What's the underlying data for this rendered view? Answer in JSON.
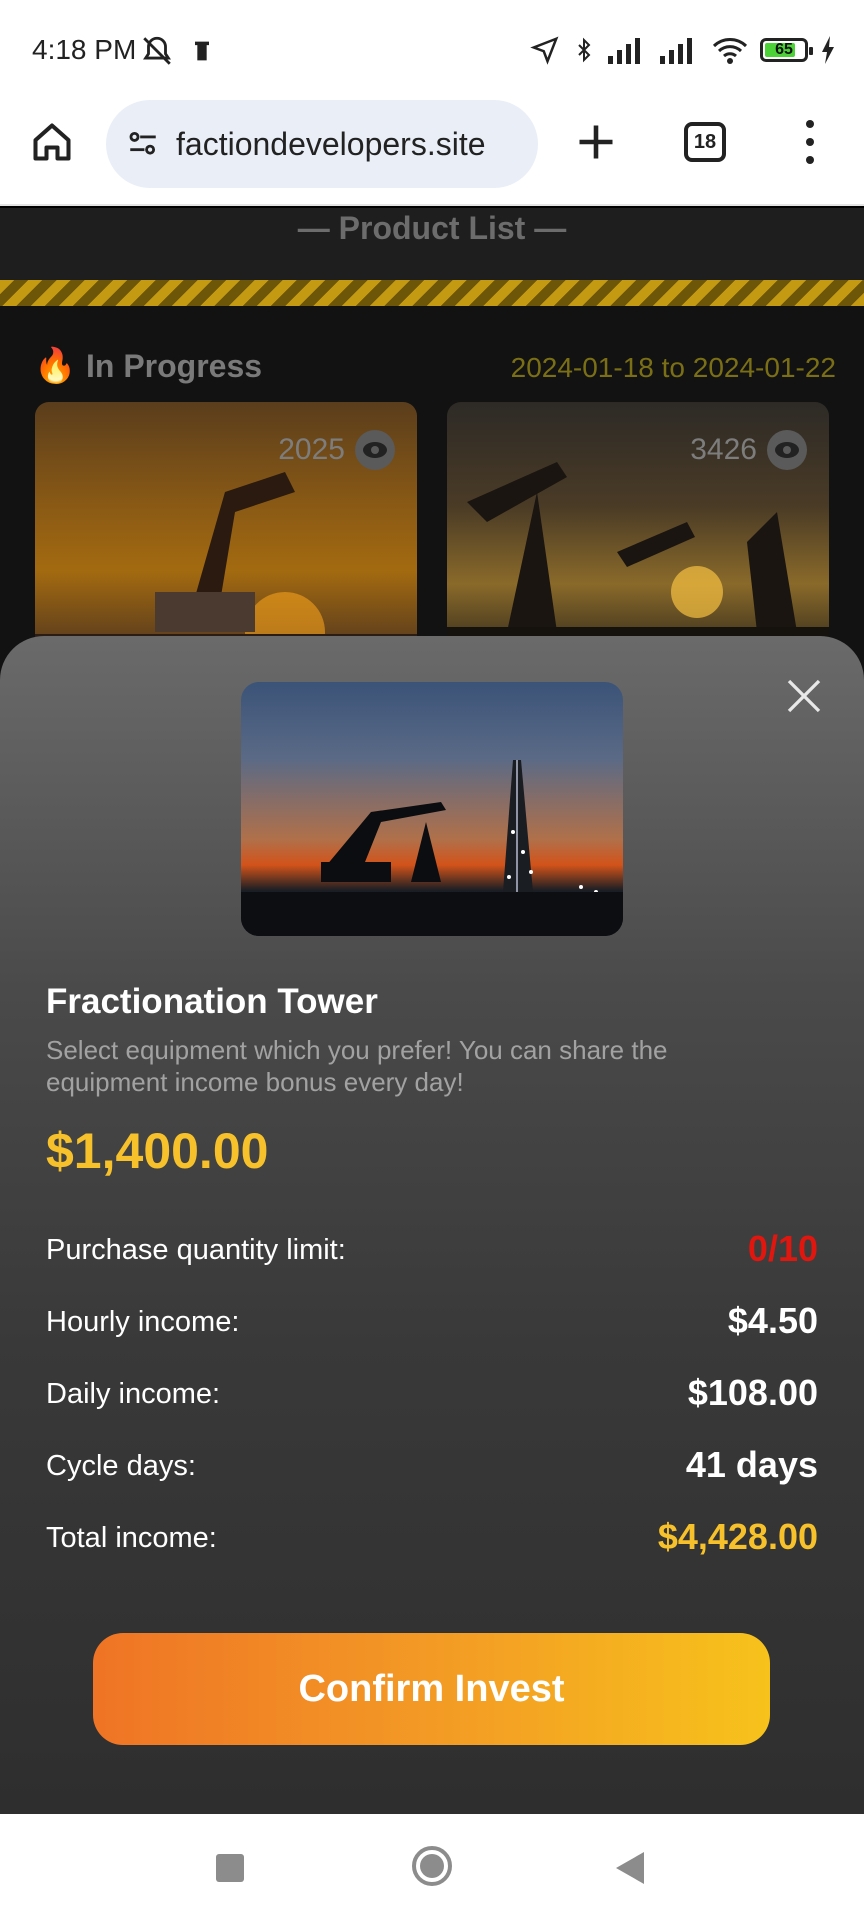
{
  "status_bar": {
    "time": "4:18 PM",
    "battery": "65",
    "icons": [
      "mute-icon",
      "shield-icon",
      "location-icon",
      "bluetooth-icon",
      "signal-icon",
      "signal-icon",
      "wifi-icon",
      "battery-icon",
      "charging-icon"
    ]
  },
  "browser": {
    "url": "factiondevelopers.site",
    "tab_count": "18"
  },
  "page": {
    "section_title": "— Product List —",
    "status_label": "In Progress",
    "date_range": "2024-01-18 to 2024-01-22",
    "cards": [
      {
        "views": "2025"
      },
      {
        "views": "3426"
      }
    ]
  },
  "modal": {
    "product_name": "Fractionation Tower",
    "description": "Select equipment which you prefer! You can share the equipment income bonus every day!",
    "price": "$1,400.00",
    "rows": [
      {
        "label": "Purchase quantity limit:",
        "value": "0/10"
      },
      {
        "label": "Hourly income:",
        "value": "$4.50"
      },
      {
        "label": "Daily income:",
        "value": "$108.00"
      },
      {
        "label": "Cycle days:",
        "value": "41 days"
      },
      {
        "label": "Total income:",
        "value": "$4,428.00"
      }
    ],
    "confirm_label": "Confirm Invest"
  },
  "colors": {
    "accent_gold": "#f6c12a",
    "limit_red": "#e0160f",
    "button_gradient_start": "#ef7425",
    "button_gradient_end": "#f7c21b"
  }
}
